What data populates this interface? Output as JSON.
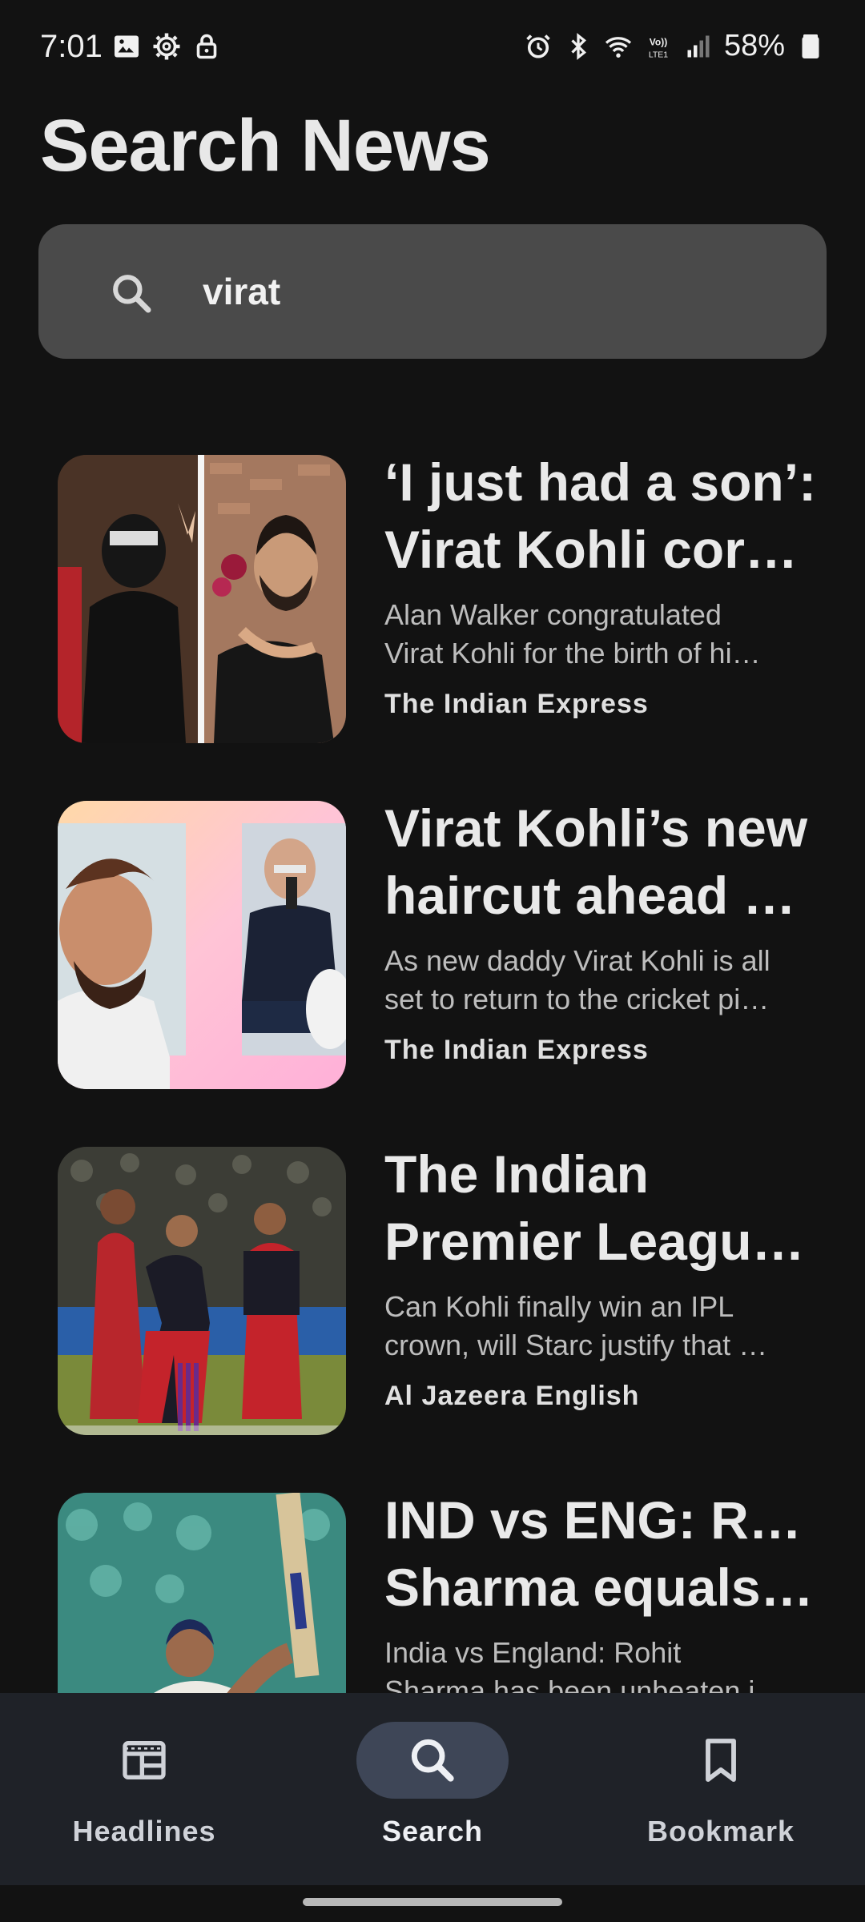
{
  "status_bar": {
    "time": "7:01",
    "battery": "58%",
    "left_icons": [
      "image-icon",
      "settings-icon",
      "lock-icon"
    ],
    "right_icons": [
      "alarm-icon",
      "bluetooth-icon",
      "wifi-icon",
      "volte-icon",
      "signal-icon",
      "battery-icon"
    ]
  },
  "page": {
    "title": "Search News"
  },
  "search": {
    "value": "virat",
    "icon": "search-icon"
  },
  "results": [
    {
      "title_line1": "‘I just had a son’:",
      "title_line2": "Virat Kohli corre…",
      "desc_line1": "Alan Walker congratulated",
      "desc_line2": "Virat Kohli for the birth of hi…",
      "source": "The Indian Express"
    },
    {
      "title_line1": "Virat Kohli’s new",
      "title_line2": "haircut ahead of…",
      "desc_line1": "As new daddy Virat Kohli is all",
      "desc_line2": "set to return to the cricket pi…",
      "source": "The Indian Express"
    },
    {
      "title_line1": "The Indian",
      "title_line2": "Premier League…",
      "desc_line1": "Can Kohli finally win an IPL",
      "desc_line2": "crown, will Starc justify that …",
      "source": "Al Jazeera English"
    },
    {
      "title_line1": "IND vs ENG: Rohit",
      "title_line2": "Sharma equals …",
      "desc_line1": "India vs England: Rohit",
      "desc_line2": "Sharma has been unbeaten i…",
      "source": ""
    }
  ],
  "nav": {
    "items": [
      {
        "label": "Headlines",
        "icon": "newspaper-icon",
        "active": false
      },
      {
        "label": "Search",
        "icon": "search-icon",
        "active": true
      },
      {
        "label": "Bookmark",
        "icon": "bookmark-icon",
        "active": false
      }
    ]
  },
  "colors": {
    "background": "#121212",
    "search_box": "#4a4a4a",
    "nav_background": "#1f2228",
    "nav_active_pill": "#3e4657"
  }
}
